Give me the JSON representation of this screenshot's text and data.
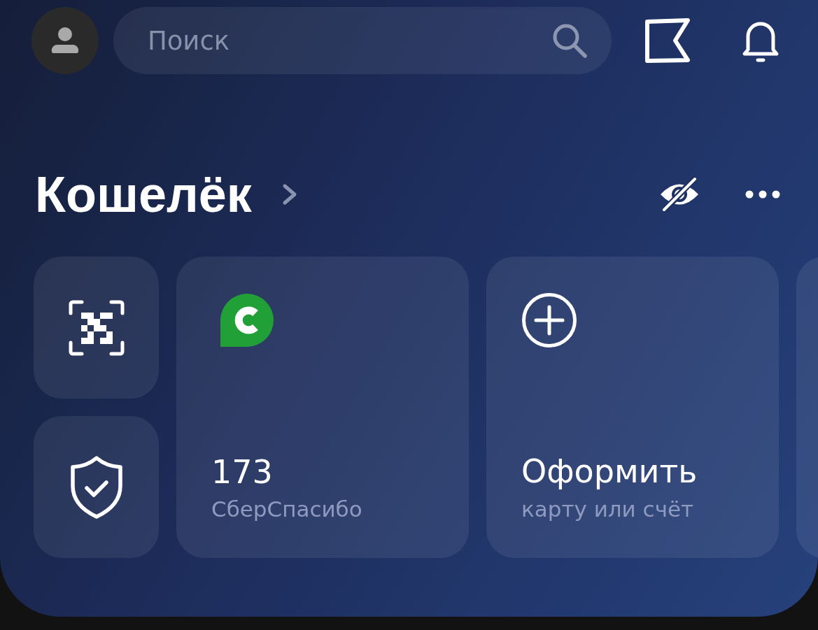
{
  "search": {
    "placeholder": "Поиск"
  },
  "wallet": {
    "title": "Кошелёк",
    "cards": [
      {
        "kind": "bonus",
        "value": "173",
        "label": "СберСпасибо"
      },
      {
        "kind": "action",
        "title": "Оформить",
        "subtitle": "карту или счёт"
      },
      {
        "kind": "blank"
      }
    ]
  }
}
